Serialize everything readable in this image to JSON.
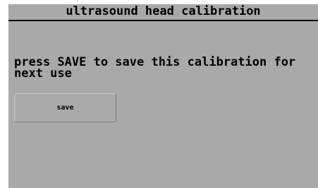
{
  "header": {
    "title": "ultrasound head calibration"
  },
  "main": {
    "message": "press SAVE to save this calibration for\nnext use",
    "save_label": "save"
  },
  "colors": {
    "background": "#a9a9a9",
    "text": "#000000",
    "frame": "#ffffff"
  }
}
